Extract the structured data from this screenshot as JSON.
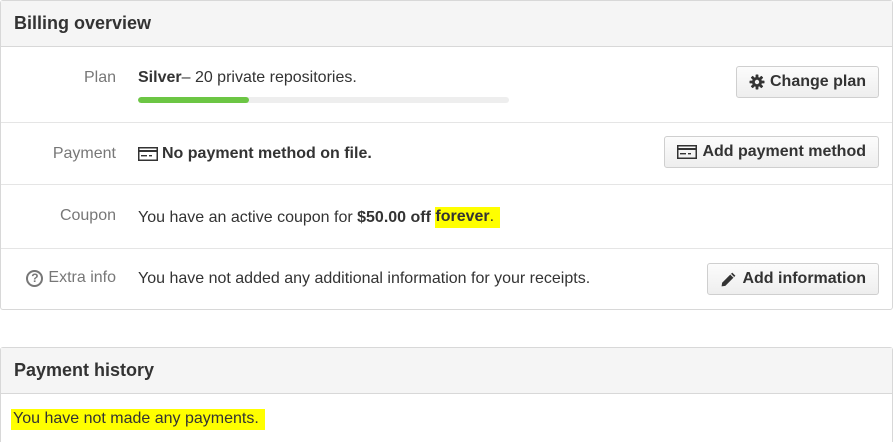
{
  "billing": {
    "title": "Billing overview",
    "plan": {
      "label": "Plan",
      "name": "Silver",
      "description": " – 20 private repositories.",
      "usage_fraction": 0.3,
      "button": "Change plan",
      "button_icon": "gear-icon"
    },
    "payment": {
      "label": "Payment",
      "value": "No payment method on file.",
      "value_icon": "credit-card-icon",
      "button": "Add payment method",
      "button_icon": "credit-card-icon"
    },
    "coupon": {
      "label": "Coupon",
      "text_prefix": "You have an active coupon for ",
      "amount": "$50.00 off",
      "duration": "forever",
      "text_suffix": "."
    },
    "extra_info": {
      "label": "Extra info",
      "label_icon": "question-circle-icon",
      "value": "You have not added any additional information for your receipts.",
      "button": "Add information",
      "button_icon": "pencil-icon"
    }
  },
  "history": {
    "title": "Payment history",
    "message": "You have not made any payments."
  },
  "colors": {
    "progress": "#6cc644",
    "highlight": "#ffff00"
  }
}
